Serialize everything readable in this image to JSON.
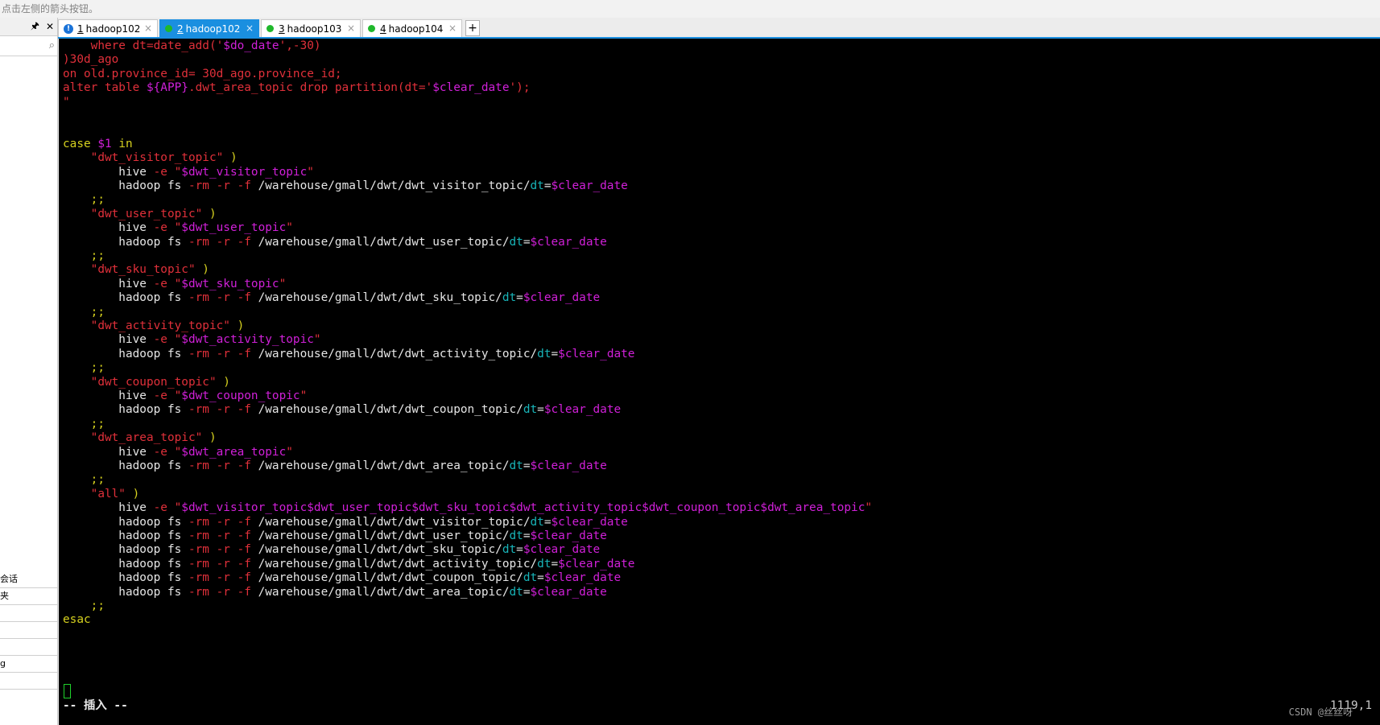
{
  "hint_text": "点击左侧的箭头按钮。",
  "sidebar": {
    "pin_icon": "pin-icon",
    "close_icon": "close-icon",
    "rows": [
      "会话",
      "夹",
      "",
      "",
      "",
      "g",
      ""
    ]
  },
  "tabs": [
    {
      "num": "1",
      "label": "hadoop102",
      "status": "warning",
      "active": false
    },
    {
      "num": "2",
      "label": "hadoop102",
      "status": "connected",
      "active": true
    },
    {
      "num": "3",
      "label": "hadoop103",
      "status": "connected",
      "active": false
    },
    {
      "num": "4",
      "label": "hadoop104",
      "status": "connected",
      "active": false
    }
  ],
  "add_tab_label": "+",
  "colors": {
    "default": "#e6e6e6",
    "keyword": "#d6d11f",
    "red": "#e0303a",
    "magenta": "#d020d8",
    "cyan": "#18b4b8",
    "terminal_bg": "#000000",
    "tab_active": "#1a8fe0"
  },
  "terminal_lines": [
    [
      [
        "    where dt=date_add('",
        "red"
      ],
      [
        "$do_date",
        "magenta"
      ],
      [
        "',-30)",
        "red"
      ]
    ],
    [
      [
        ")30d_ago",
        "red"
      ]
    ],
    [
      [
        "on old.province_id= 30d_ago.province_id;",
        "red"
      ]
    ],
    [
      [
        "alter table ",
        "red"
      ],
      [
        "${APP}",
        "magenta"
      ],
      [
        ".dwt_area_topic drop partition(dt='",
        "red"
      ],
      [
        "$clear_date",
        "magenta"
      ],
      [
        "');",
        "red"
      ]
    ],
    [
      [
        "\"",
        "red"
      ]
    ],
    [],
    [],
    [
      [
        "case ",
        "keyword"
      ],
      [
        "$1",
        "magenta"
      ],
      [
        " in",
        "keyword"
      ]
    ],
    [
      [
        "    \"dwt_visitor_topic\"",
        "red"
      ],
      [
        " )",
        "keyword"
      ]
    ],
    [
      [
        "        hive ",
        "default"
      ],
      [
        "-e",
        "red"
      ],
      [
        " \"",
        "red"
      ],
      [
        "$dwt_visitor_topic",
        "magenta"
      ],
      [
        "\"",
        "red"
      ]
    ],
    [
      [
        "        hadoop fs ",
        "default"
      ],
      [
        "-rm -r -f",
        "red"
      ],
      [
        " /warehouse/gmall/dwt/dwt_visitor_topic/",
        "default"
      ],
      [
        "dt",
        "cyan"
      ],
      [
        "=",
        "default"
      ],
      [
        "$clear_date",
        "magenta"
      ]
    ],
    [
      [
        "    ;;",
        "keyword"
      ]
    ],
    [
      [
        "    \"dwt_user_topic\"",
        "red"
      ],
      [
        " )",
        "keyword"
      ]
    ],
    [
      [
        "        hive ",
        "default"
      ],
      [
        "-e",
        "red"
      ],
      [
        " \"",
        "red"
      ],
      [
        "$dwt_user_topic",
        "magenta"
      ],
      [
        "\"",
        "red"
      ]
    ],
    [
      [
        "        hadoop fs ",
        "default"
      ],
      [
        "-rm -r -f",
        "red"
      ],
      [
        " /warehouse/gmall/dwt/dwt_user_topic/",
        "default"
      ],
      [
        "dt",
        "cyan"
      ],
      [
        "=",
        "default"
      ],
      [
        "$clear_date",
        "magenta"
      ]
    ],
    [
      [
        "    ;;",
        "keyword"
      ]
    ],
    [
      [
        "    \"dwt_sku_topic\"",
        "red"
      ],
      [
        " )",
        "keyword"
      ]
    ],
    [
      [
        "        hive ",
        "default"
      ],
      [
        "-e",
        "red"
      ],
      [
        " \"",
        "red"
      ],
      [
        "$dwt_sku_topic",
        "magenta"
      ],
      [
        "\"",
        "red"
      ]
    ],
    [
      [
        "        hadoop fs ",
        "default"
      ],
      [
        "-rm -r -f",
        "red"
      ],
      [
        " /warehouse/gmall/dwt/dwt_sku_topic/",
        "default"
      ],
      [
        "dt",
        "cyan"
      ],
      [
        "=",
        "default"
      ],
      [
        "$clear_date",
        "magenta"
      ]
    ],
    [
      [
        "    ;;",
        "keyword"
      ]
    ],
    [
      [
        "    \"dwt_activity_topic\"",
        "red"
      ],
      [
        " )",
        "keyword"
      ]
    ],
    [
      [
        "        hive ",
        "default"
      ],
      [
        "-e",
        "red"
      ],
      [
        " \"",
        "red"
      ],
      [
        "$dwt_activity_topic",
        "magenta"
      ],
      [
        "\"",
        "red"
      ]
    ],
    [
      [
        "        hadoop fs ",
        "default"
      ],
      [
        "-rm -r -f",
        "red"
      ],
      [
        " /warehouse/gmall/dwt/dwt_activity_topic/",
        "default"
      ],
      [
        "dt",
        "cyan"
      ],
      [
        "=",
        "default"
      ],
      [
        "$clear_date",
        "magenta"
      ]
    ],
    [
      [
        "    ;;",
        "keyword"
      ]
    ],
    [
      [
        "    \"dwt_coupon_topic\"",
        "red"
      ],
      [
        " )",
        "keyword"
      ]
    ],
    [
      [
        "        hive ",
        "default"
      ],
      [
        "-e",
        "red"
      ],
      [
        " \"",
        "red"
      ],
      [
        "$dwt_coupon_topic",
        "magenta"
      ],
      [
        "\"",
        "red"
      ]
    ],
    [
      [
        "        hadoop fs ",
        "default"
      ],
      [
        "-rm -r -f",
        "red"
      ],
      [
        " /warehouse/gmall/dwt/dwt_coupon_topic/",
        "default"
      ],
      [
        "dt",
        "cyan"
      ],
      [
        "=",
        "default"
      ],
      [
        "$clear_date",
        "magenta"
      ]
    ],
    [
      [
        "    ;;",
        "keyword"
      ]
    ],
    [
      [
        "    \"dwt_area_topic\"",
        "red"
      ],
      [
        " )",
        "keyword"
      ]
    ],
    [
      [
        "        hive ",
        "default"
      ],
      [
        "-e",
        "red"
      ],
      [
        " \"",
        "red"
      ],
      [
        "$dwt_area_topic",
        "magenta"
      ],
      [
        "\"",
        "red"
      ]
    ],
    [
      [
        "        hadoop fs ",
        "default"
      ],
      [
        "-rm -r -f",
        "red"
      ],
      [
        " /warehouse/gmall/dwt/dwt_area_topic/",
        "default"
      ],
      [
        "dt",
        "cyan"
      ],
      [
        "=",
        "default"
      ],
      [
        "$clear_date",
        "magenta"
      ]
    ],
    [
      [
        "    ;;",
        "keyword"
      ]
    ],
    [
      [
        "    \"all\"",
        "red"
      ],
      [
        " )",
        "keyword"
      ]
    ],
    [
      [
        "        hive ",
        "default"
      ],
      [
        "-e",
        "red"
      ],
      [
        " \"",
        "red"
      ],
      [
        "$dwt_visitor_topic$dwt_user_topic$dwt_sku_topic$dwt_activity_topic$dwt_coupon_topic$dwt_area_topic",
        "magenta"
      ],
      [
        "\"",
        "red"
      ]
    ],
    [
      [
        "        hadoop fs ",
        "default"
      ],
      [
        "-rm -r -f",
        "red"
      ],
      [
        " /warehouse/gmall/dwt/dwt_visitor_topic/",
        "default"
      ],
      [
        "dt",
        "cyan"
      ],
      [
        "=",
        "default"
      ],
      [
        "$clear_date",
        "magenta"
      ]
    ],
    [
      [
        "        hadoop fs ",
        "default"
      ],
      [
        "-rm -r -f",
        "red"
      ],
      [
        " /warehouse/gmall/dwt/dwt_user_topic/",
        "default"
      ],
      [
        "dt",
        "cyan"
      ],
      [
        "=",
        "default"
      ],
      [
        "$clear_date",
        "magenta"
      ]
    ],
    [
      [
        "        hadoop fs ",
        "default"
      ],
      [
        "-rm -r -f",
        "red"
      ],
      [
        " /warehouse/gmall/dwt/dwt_sku_topic/",
        "default"
      ],
      [
        "dt",
        "cyan"
      ],
      [
        "=",
        "default"
      ],
      [
        "$clear_date",
        "magenta"
      ]
    ],
    [
      [
        "        hadoop fs ",
        "default"
      ],
      [
        "-rm -r -f",
        "red"
      ],
      [
        " /warehouse/gmall/dwt/dwt_activity_topic/",
        "default"
      ],
      [
        "dt",
        "cyan"
      ],
      [
        "=",
        "default"
      ],
      [
        "$clear_date",
        "magenta"
      ]
    ],
    [
      [
        "        hadoop fs ",
        "default"
      ],
      [
        "-rm -r -f",
        "red"
      ],
      [
        " /warehouse/gmall/dwt/dwt_coupon_topic/",
        "default"
      ],
      [
        "dt",
        "cyan"
      ],
      [
        "=",
        "default"
      ],
      [
        "$clear_date",
        "magenta"
      ]
    ],
    [
      [
        "        hadoop fs ",
        "default"
      ],
      [
        "-rm -r -f",
        "red"
      ],
      [
        " /warehouse/gmall/dwt/dwt_area_topic/",
        "default"
      ],
      [
        "dt",
        "cyan"
      ],
      [
        "=",
        "default"
      ],
      [
        "$clear_date",
        "magenta"
      ]
    ],
    [
      [
        "    ;;",
        "keyword"
      ]
    ],
    [
      [
        "esac",
        "keyword"
      ]
    ]
  ],
  "status": {
    "mode": "-- 插入 --",
    "position": "1119,1",
    "watermark": "CSDN @丝丝呀"
  }
}
